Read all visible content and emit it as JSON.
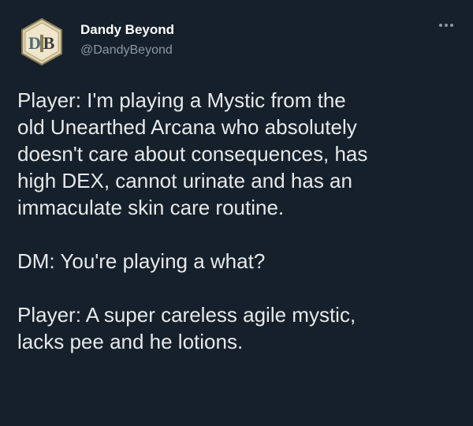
{
  "tweet": {
    "author": {
      "display_name": "Dandy Beyond",
      "handle": "@DandyBeyond",
      "avatar_icon": "d-and-b-logo-icon",
      "avatar_letters": "D B"
    },
    "more_icon": "more-horizontal-icon",
    "paragraphs": [
      "Player: I'm playing a Mystic from the\nold Unearthed Arcana who absolutely\ndoesn't care about consequences, has\nhigh DEX, cannot urinate and has an\nimmaculate skin care routine.",
      "DM: You're playing a what?",
      "Player: A super careless agile mystic,\nlacks pee and he lotions."
    ]
  },
  "colors": {
    "background": "#15202b",
    "text": "#e7e9ea",
    "secondary_text": "#8b98a5",
    "avatar_frame": "#c9b78a"
  }
}
